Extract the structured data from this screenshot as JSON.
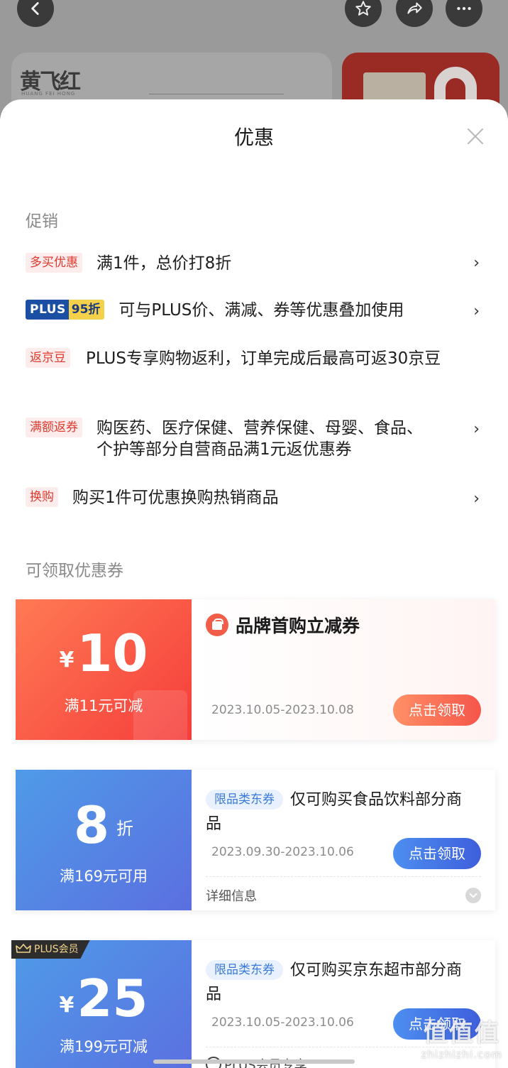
{
  "background": {
    "brand_logo": "黄飞红",
    "brand_sub": "HUANG FEI HONG"
  },
  "sheet": {
    "title": "优惠",
    "promo_section": "促销",
    "coupon_section": "可领取优惠券"
  },
  "promotions": [
    {
      "tag": "多买优惠",
      "text": "满1件，总价打8折",
      "chevron": "›"
    },
    {
      "tag_plus": "PLUS",
      "tag_discount": "95折",
      "text": "可与PLUS价、满减、券等优惠叠加使用",
      "chevron": "›"
    },
    {
      "tag": "返京豆",
      "text": "PLUS专享购物返利，订单完成后最高可返30京豆"
    },
    {
      "tag": "满额返券",
      "text": "购医药、医疗保健、营养保健、母婴、食品、个护等部分自营商品满1元返优惠券",
      "chevron": "›"
    },
    {
      "tag": "换购",
      "text": "购买1件可优惠换购热销商品",
      "chevron": "›"
    }
  ],
  "coupons": [
    {
      "currency": "¥",
      "amount": "10",
      "condition": "满11元可减",
      "title": "品牌首购立减券",
      "date": "2023.10.05-2023.10.08",
      "button": "点击领取"
    },
    {
      "amount": "8",
      "unit": "折",
      "condition": "满169元可用",
      "tag": "限品类东券",
      "title": "仅可购买食品饮料部分商品",
      "date": "2023.09.30-2023.10.06",
      "button": "点击领取",
      "detail": "详细信息"
    },
    {
      "badge": "PLUS会员",
      "currency": "¥",
      "amount": "25",
      "condition": "满199元可减",
      "tag": "限品类东券",
      "title": "仅可购买京东超市部分商品",
      "date": "2023.10.05-2023.10.06",
      "button": "点击领取",
      "footer": "PLUS会员专享"
    }
  ],
  "watermark": {
    "main": "值值值",
    "sub": "zhizhizhi.com"
  },
  "colors": {
    "accent_red": "#f53d3b",
    "accent_blue": "#3e5edc",
    "tag_red": "#e03a2f"
  }
}
